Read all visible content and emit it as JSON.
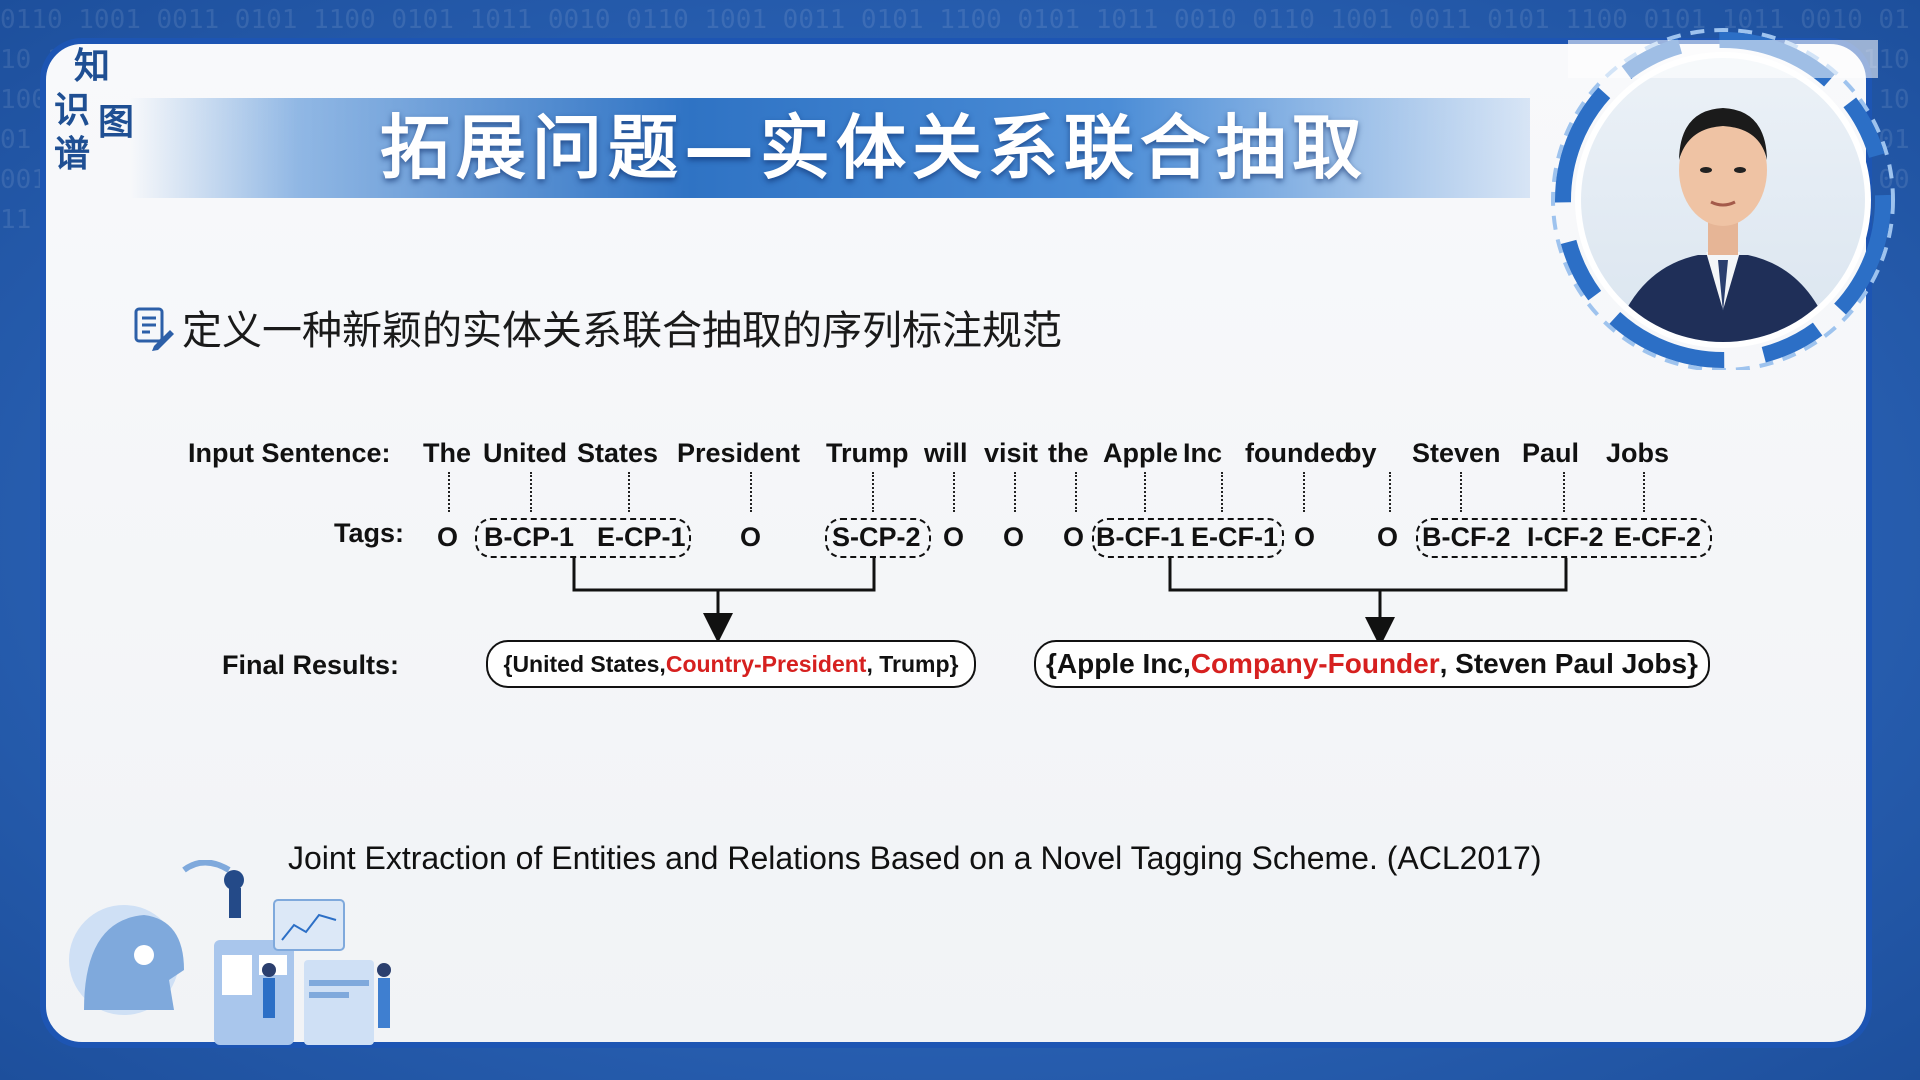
{
  "slide": {
    "logo_chars": [
      "知",
      "识",
      "图",
      "谱"
    ],
    "logo_small_text": "",
    "title": "拓展问题—实体关系联合抽取",
    "subtitle": "定义一种新颖的实体关系联合抽取的序列标注规范",
    "bullet_icon": "notes-pen-icon"
  },
  "diagram": {
    "input_label": "Input Sentence:",
    "tags_label": "Tags:",
    "results_label": "Final Results:",
    "words": [
      "The",
      "United",
      "States",
      "President",
      "Trump",
      "will",
      "visit",
      "the",
      "Apple",
      "Inc",
      "founded",
      "by",
      "Steven",
      "Paul",
      "Jobs"
    ],
    "tags": [
      "O",
      "B-CP-1",
      "E-CP-1",
      "O",
      "S-CP-2",
      "O",
      "O",
      "O",
      "B-CF-1",
      "E-CF-1",
      "O",
      "O",
      "B-CF-2",
      "I-CF-2",
      "E-CF-2"
    ],
    "result1": {
      "open": "{United States, ",
      "relation": "Country-President",
      "close": ", Trump}"
    },
    "result2": {
      "open": "{Apple Inc, ",
      "relation": "Company-Founder",
      "close": ", Steven Paul Jobs}"
    },
    "relation_color": "#d6201f"
  },
  "citation": "Joint Extraction of Entities and Relations Based on a Novel Tagging Scheme. (ACL2017)",
  "colors": {
    "frame": "#1d55b3",
    "title_band": "#2f73c4",
    "background": "#2a62b5"
  }
}
